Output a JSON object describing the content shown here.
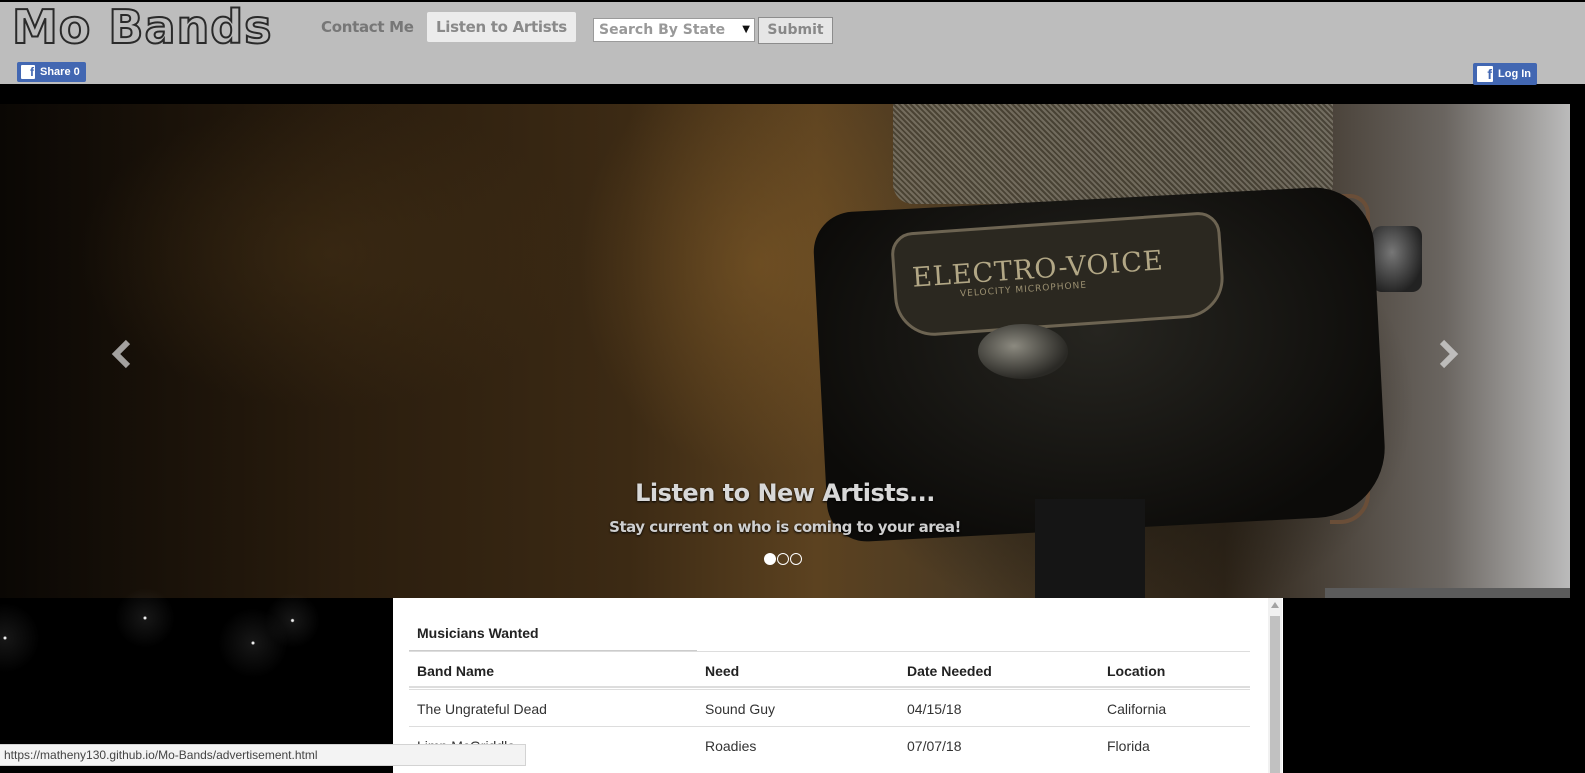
{
  "header": {
    "logo": "Mo Bands",
    "nav": {
      "contact": "Contact Me",
      "listen": "Listen to Artists"
    },
    "state_select": {
      "value": "Search By State"
    },
    "submit_label": "Submit",
    "fb_share_label": "Share 0",
    "fb_login_label": "Log In"
  },
  "carousel": {
    "brand_text": "ELECTRO-VOICE",
    "brand_sub": "VELOCITY MICROPHONE",
    "title": "Listen to New Artists...",
    "subtitle": "Stay current on who is coming to your area!",
    "slide_count": 3,
    "active_index": 0,
    "arrow_prev_icon": "chevron-left-icon",
    "arrow_next_icon": "chevron-right-icon"
  },
  "musicians": {
    "title": "Musicians Wanted",
    "headers": [
      "Band Name",
      "Need",
      "Date Needed",
      "Location"
    ],
    "rows": [
      [
        "The Ungrateful Dead",
        "Sound Guy",
        "04/15/18",
        "California"
      ],
      [
        "Limp McGriddle",
        "Roadies",
        "07/07/18",
        "Florida"
      ]
    ]
  },
  "status_bar": {
    "url": "https://matheny130.github.io/Mo-Bands/advertisement.html"
  },
  "colors": {
    "navbar_bg": "#bdbdbd",
    "facebook_blue": "#4267b2",
    "page_bg": "#000000"
  }
}
